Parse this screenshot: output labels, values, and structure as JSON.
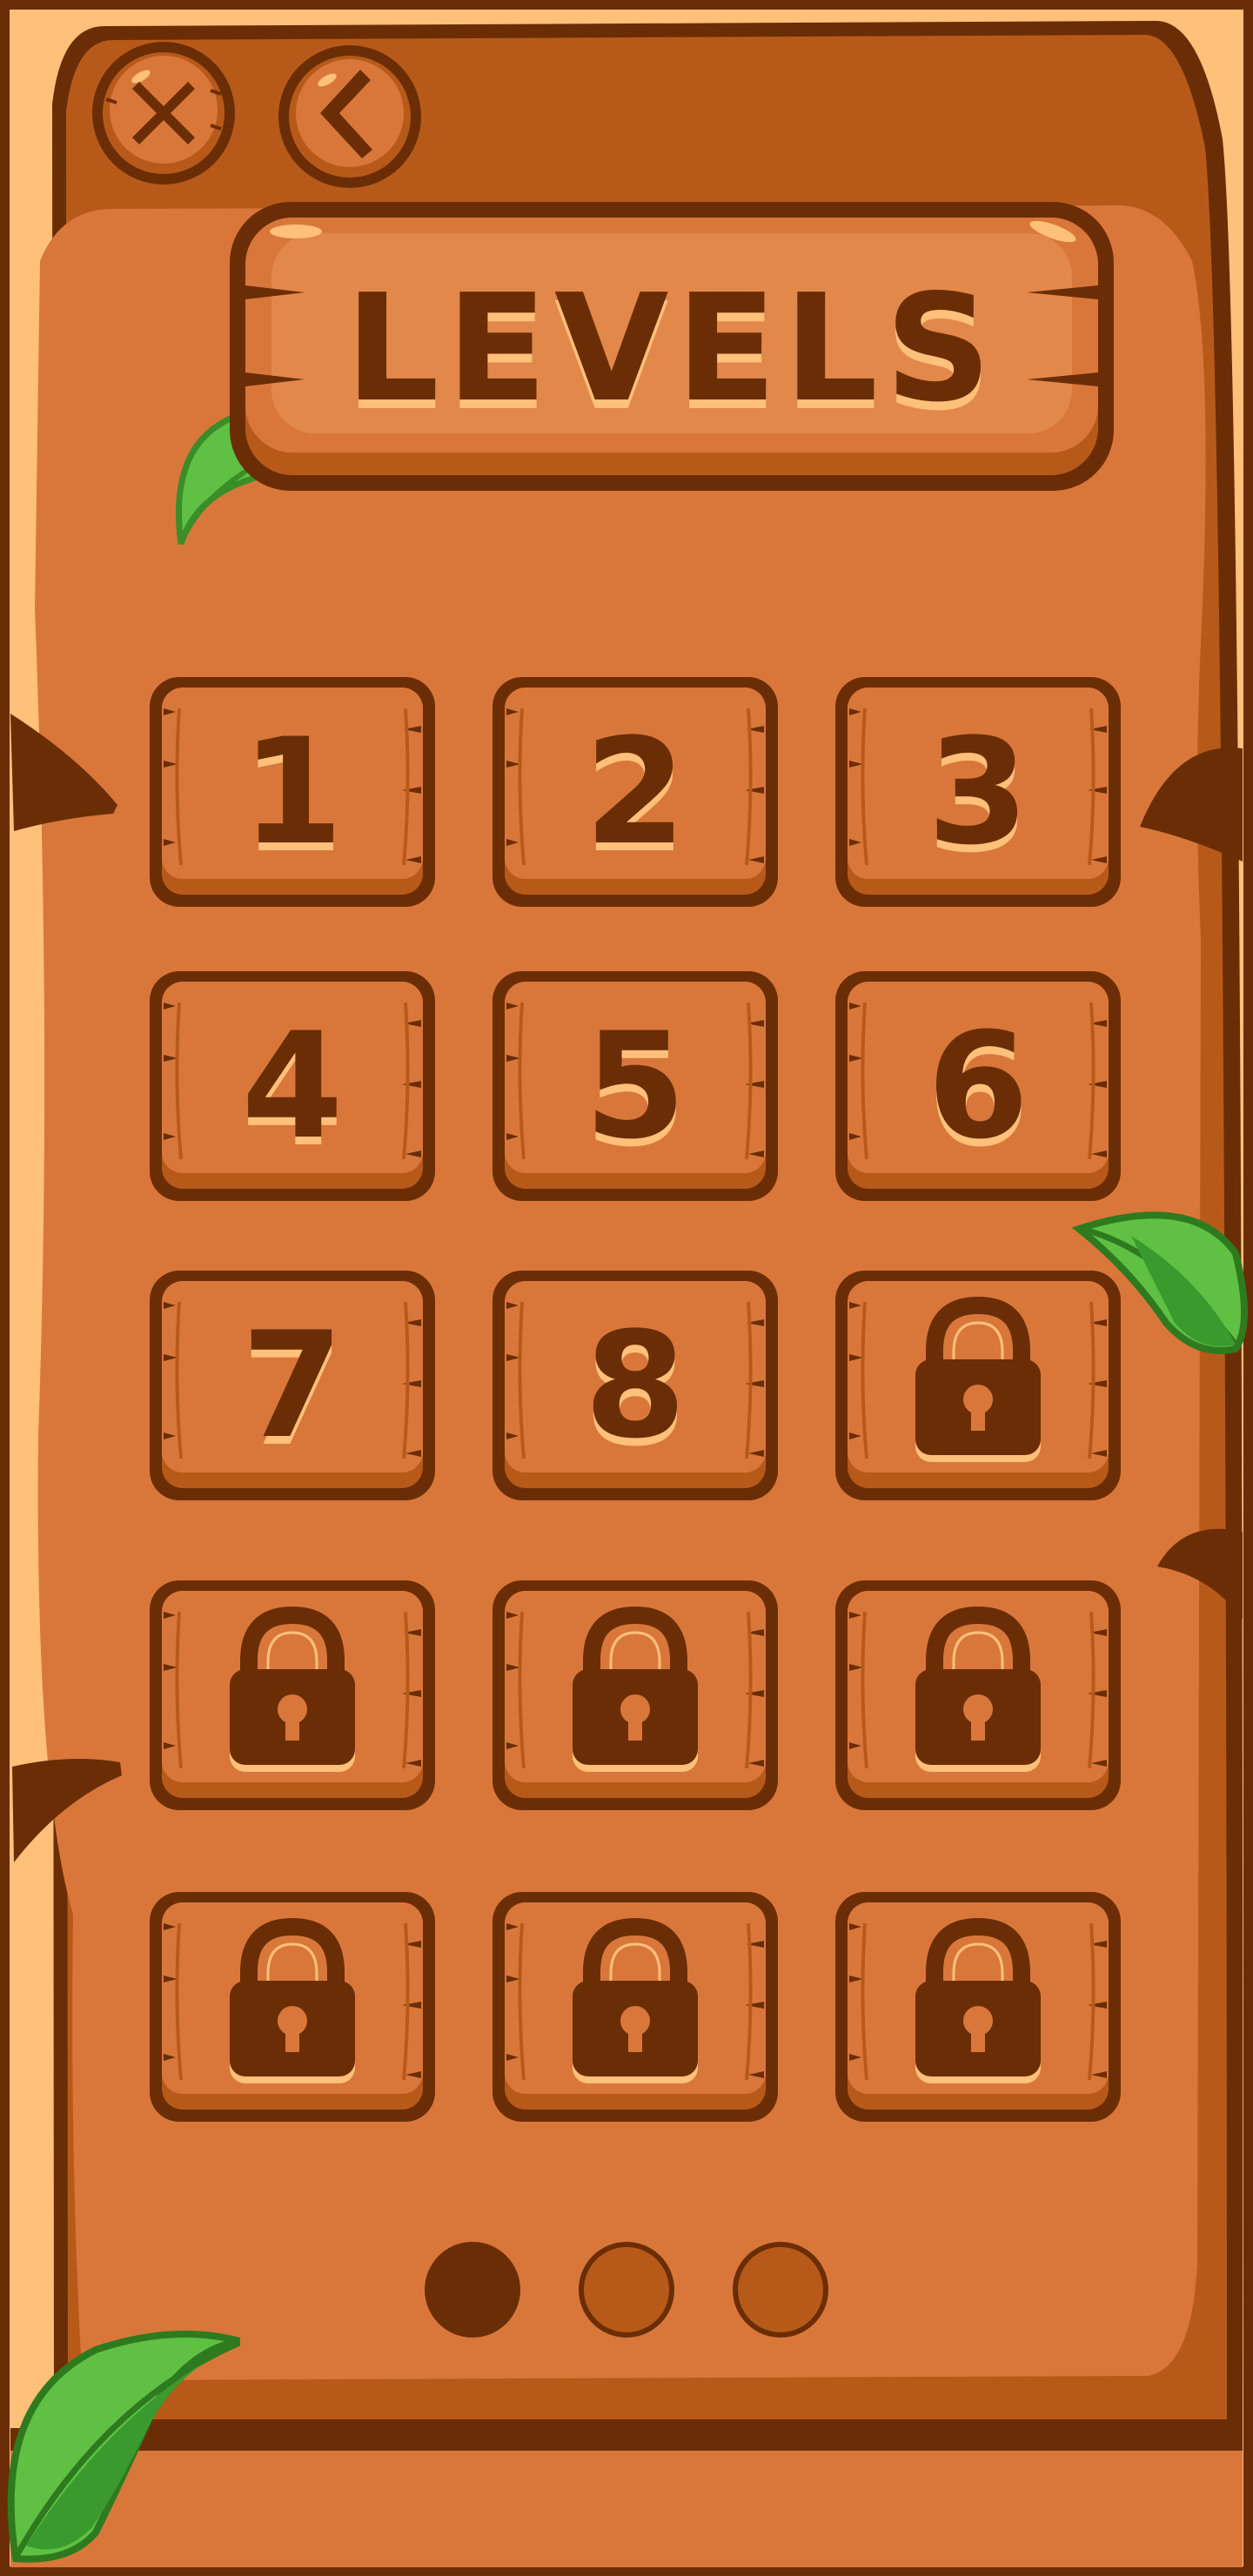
{
  "title": "LEVELS",
  "buttons": {
    "close_icon": "close-icon",
    "back_icon": "chevron-left-icon"
  },
  "levels": [
    {
      "label": "1",
      "locked": false
    },
    {
      "label": "2",
      "locked": false
    },
    {
      "label": "3",
      "locked": false
    },
    {
      "label": "4",
      "locked": false
    },
    {
      "label": "5",
      "locked": false
    },
    {
      "label": "6",
      "locked": false
    },
    {
      "label": "7",
      "locked": false
    },
    {
      "label": "8",
      "locked": false
    },
    {
      "label": "",
      "locked": true
    },
    {
      "label": "",
      "locked": true
    },
    {
      "label": "",
      "locked": true
    },
    {
      "label": "",
      "locked": true
    },
    {
      "label": "",
      "locked": true
    },
    {
      "label": "",
      "locked": true
    },
    {
      "label": "",
      "locked": true
    }
  ],
  "pagination": {
    "current": 1,
    "total": 3
  },
  "colors": {
    "dark_brown": "#6b2d05",
    "frame_orange": "#b75a19",
    "panel_orange": "#d9773b",
    "light_orange": "#e2884a",
    "highlight": "#ffc07a",
    "leaf_green": "#5fc043",
    "leaf_dark": "#3a9a2d"
  }
}
